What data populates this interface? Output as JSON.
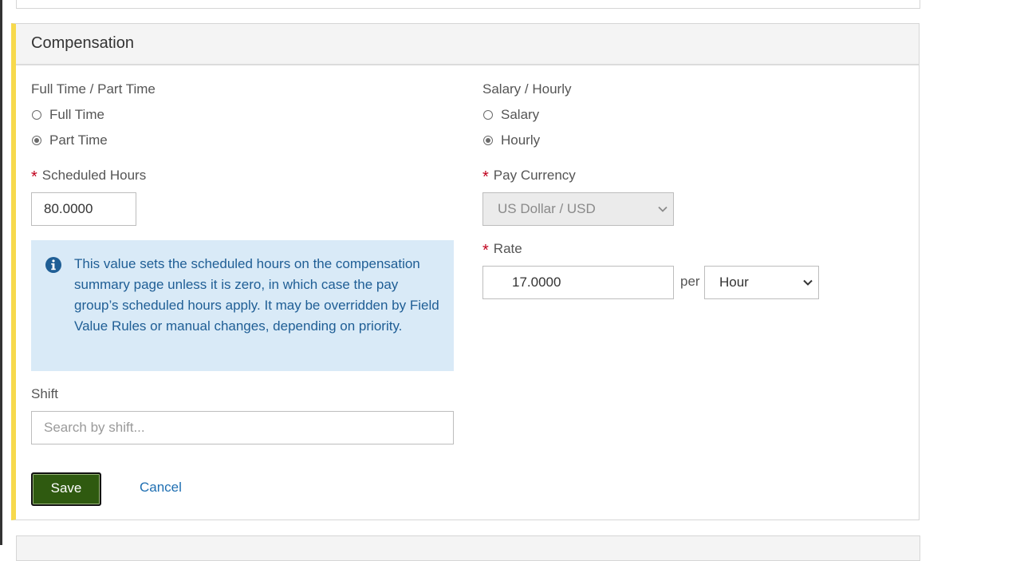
{
  "panel": {
    "title": "Compensation"
  },
  "employment_type": {
    "label": "Full Time / Part Time",
    "options": [
      {
        "label": "Full Time",
        "checked": false
      },
      {
        "label": "Part Time",
        "checked": true
      }
    ]
  },
  "pay_type": {
    "label": "Salary / Hourly",
    "options": [
      {
        "label": "Salary",
        "checked": false
      },
      {
        "label": "Hourly",
        "checked": true
      }
    ]
  },
  "scheduled_hours": {
    "required_mark": "*",
    "label": "Scheduled Hours",
    "value": "80.0000"
  },
  "pay_currency": {
    "required_mark": "*",
    "label": "Pay Currency",
    "selected": "US Dollar / USD",
    "disabled": true
  },
  "rate": {
    "required_mark": "*",
    "label": "Rate",
    "value": "17.0000",
    "per_label": "per",
    "period_selected": "Hour"
  },
  "info": {
    "icon": "info-circle-icon",
    "color": "#1f5e95",
    "text": "This value sets the scheduled hours on the compensation summary page unless it is zero, in which case the pay group’s scheduled hours apply. It may be overridden by Field Value Rules or manual changes, depending on priority."
  },
  "shift": {
    "label": "Shift",
    "placeholder": "Search by shift..."
  },
  "actions": {
    "save_label": "Save",
    "cancel_label": "Cancel"
  },
  "colors": {
    "accent_bar": "#f7d94c",
    "save_button": "#2f5a10",
    "link": "#1f6fb2",
    "required": "#c0001c"
  }
}
